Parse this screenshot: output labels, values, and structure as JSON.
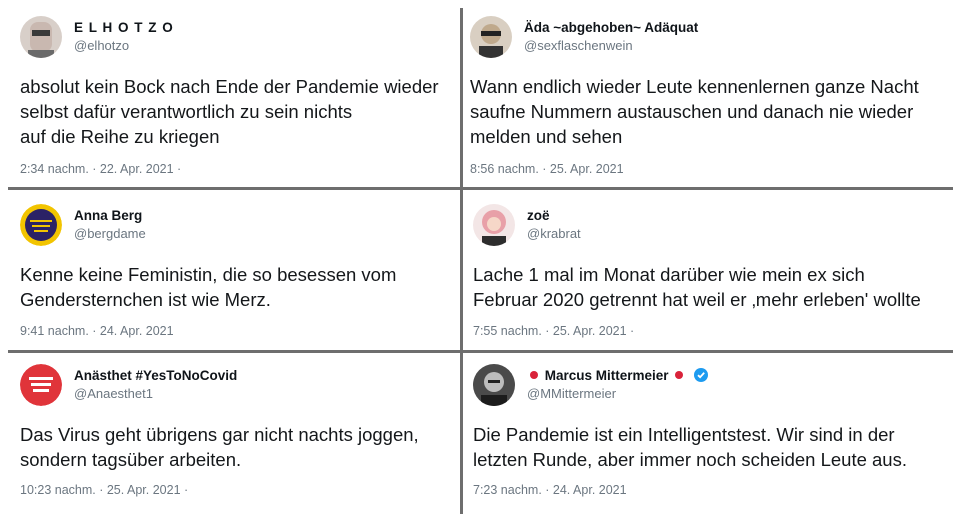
{
  "tweets": [
    {
      "name": "E L H O T Z O",
      "handle": "@elhotzo",
      "text": "absolut kein Bock nach Ende der Pandemie wieder\nselbst dafür verantwortlich zu sein nichts\nauf die Reihe zu kriegen",
      "time": "2:34 nachm. · 22. Apr. 2021 ·",
      "avatar": "person-avatar",
      "accent": "#c9b8b0"
    },
    {
      "name": "Äda ~abgehoben~ Adäquat",
      "handle": "@sexflaschenwein",
      "text": "Wann endlich wieder Leute kennenlernen ganze Nacht\nsaufne Nummern austauschen und danach nie wieder\nmelden und sehen",
      "time": "8:56 nachm. · 25. Apr. 2021",
      "avatar": "person-sunglasses-avatar",
      "accent": "#bfa98c"
    },
    {
      "name": "Anna Berg",
      "handle": "@bergdame",
      "text": "Kenne keine Feministin, die so besessen vom\nGendersternchen ist wie Merz.",
      "time": "9:41 nachm. · 24. Apr. 2021",
      "avatar": "badge-avatar",
      "badge_text": "DER FRÜHE VOGEL KANN MICH MAL",
      "accent": "#f2c400"
    },
    {
      "name": "zoë",
      "handle": "@krabrat",
      "text": "Lache 1 mal im Monat darüber wie mein ex sich\nFebruar 2020 getrennt hat weil er ‚mehr erleben' wollte",
      "time": "7:55 nachm. · 25. Apr. 2021 ·",
      "avatar": "person-pink-hair-avatar",
      "accent": "#e8a0a8"
    },
    {
      "name": "Anästhet #YesToNoCovid",
      "handle": "@Anaesthet1",
      "text": "Das Virus geht übrigens gar nicht nachts joggen,\nsondern tagsüber arbeiten.",
      "time": "10:23 nachm. · 25. Apr. 2021 ·",
      "avatar": "keep-calm-avatar",
      "badge_text": "KEEP CALM",
      "accent": "#e0343a"
    },
    {
      "name": "Marcus Mittermeier",
      "handle": "@MMittermeier",
      "text": "Die Pandemie ist ein Intelligentstest. Wir sind in der\nletzten Runde, aber immer noch scheiden Leute aus.",
      "time": "7:23 nachm. · 24. Apr. 2021",
      "avatar": "bw-portrait-avatar",
      "accent": "#1d9bf0"
    }
  ]
}
